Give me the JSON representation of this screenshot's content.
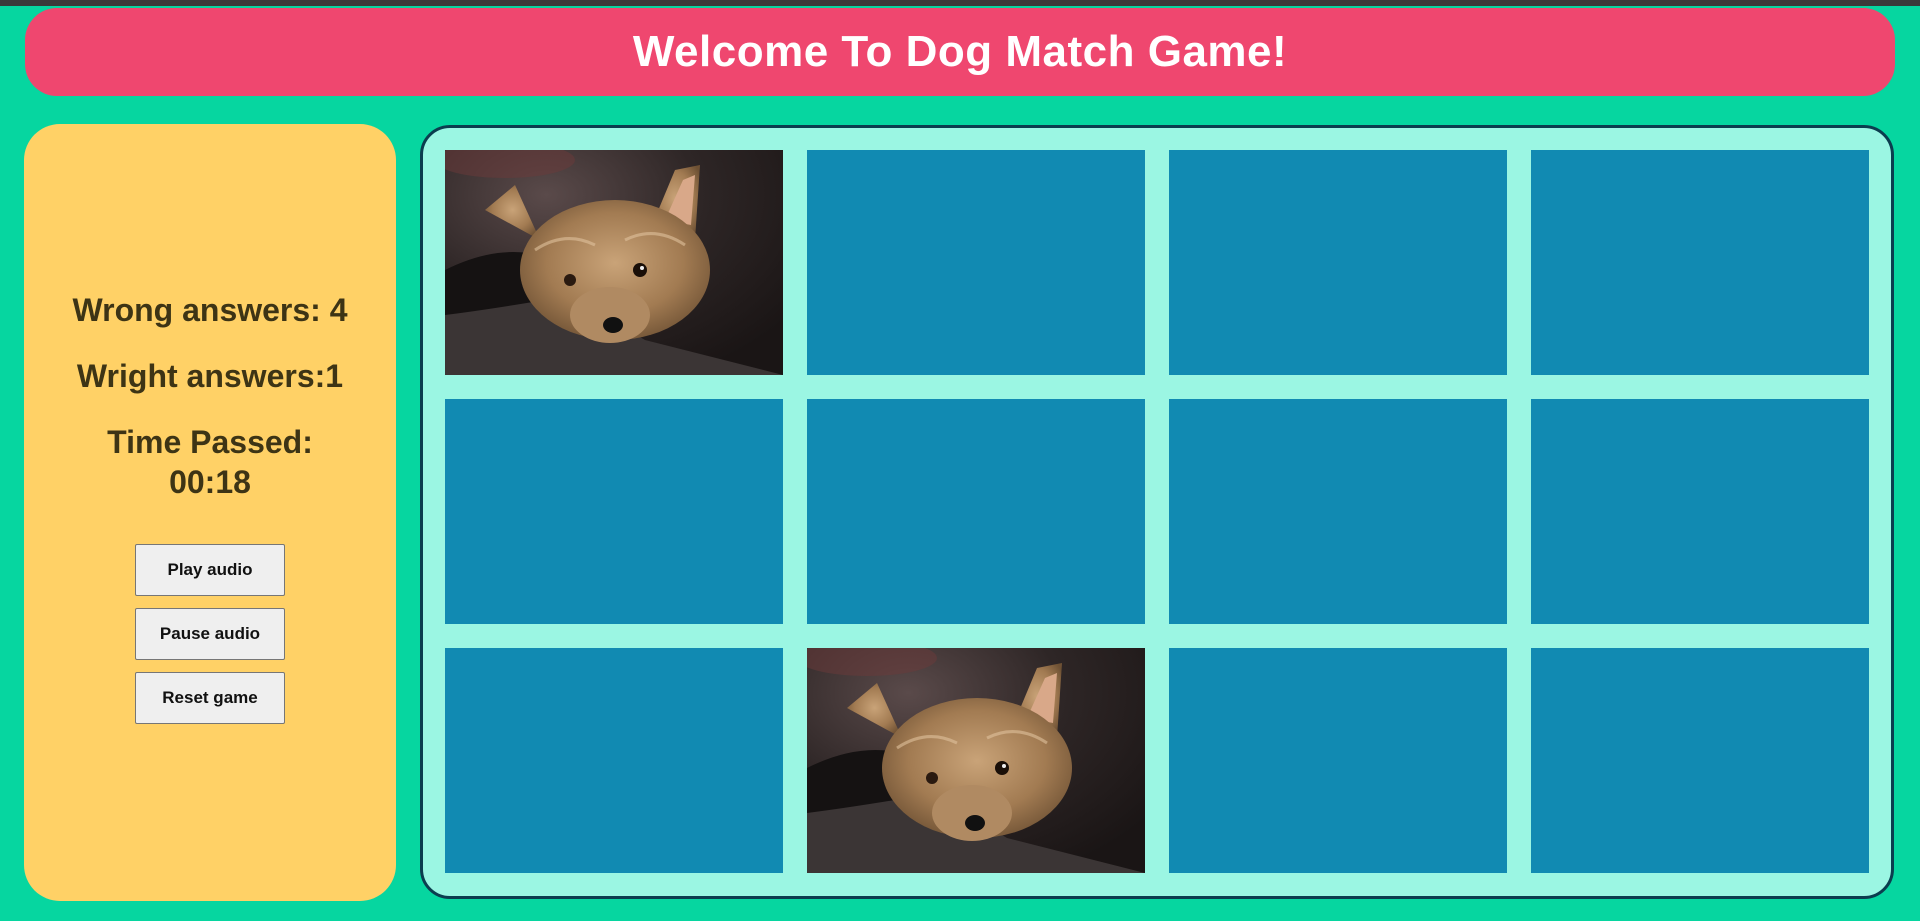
{
  "header": {
    "title": "Welcome To Dog Match Game!"
  },
  "stats": {
    "wrong": "Wrong answers: 4",
    "right": "Wright answers:1",
    "time_label": "Time Passed:",
    "time_value": "00:18"
  },
  "controls": {
    "play": "Play audio",
    "pause": "Pause audio",
    "reset": "Reset game"
  },
  "board": {
    "cards": [
      {
        "state": "revealed",
        "image": "yorkshire-terrier"
      },
      {
        "state": "hidden"
      },
      {
        "state": "hidden"
      },
      {
        "state": "hidden"
      },
      {
        "state": "hidden"
      },
      {
        "state": "hidden"
      },
      {
        "state": "hidden"
      },
      {
        "state": "hidden"
      },
      {
        "state": "hidden"
      },
      {
        "state": "revealed",
        "image": "yorkshire-terrier"
      },
      {
        "state": "hidden"
      },
      {
        "state": "hidden"
      }
    ]
  },
  "colors": {
    "background": "#06d6a0",
    "header": "#ef476f",
    "sidebar": "#ffd166",
    "board": "#9bf6e3",
    "card_back": "#118ab2"
  }
}
